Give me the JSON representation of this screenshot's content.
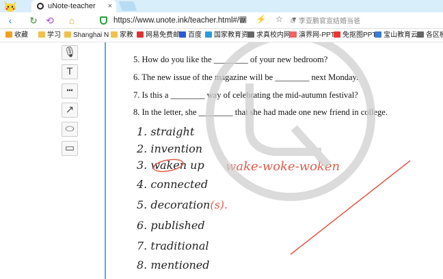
{
  "browser": {
    "tab_title": "uNote-teacher",
    "tab_close": "×",
    "url": "https://www.unote.ink/teacher.html#/w",
    "search_hint": "李亚鹏官宣结婚当爸",
    "nav": {
      "back": "‹",
      "refresh": "↻",
      "undo": "⟲",
      "home": "⌂"
    },
    "addr_icons": [
      "▦",
      "⚡",
      "☆",
      "▾"
    ],
    "bookmarks": [
      {
        "label": "收藏",
        "icon": "star-icon",
        "color": "#f0a020"
      },
      {
        "label": "学习",
        "icon": "folder-icon",
        "color": "#f0c14b"
      },
      {
        "label": "Shanghai N",
        "icon": "folder-icon",
        "color": "#f0c14b"
      },
      {
        "label": "家教",
        "icon": "folder-icon",
        "color": "#f0c14b"
      },
      {
        "label": "网易免费邮",
        "icon": "mail-icon",
        "color": "#d33"
      },
      {
        "label": "百度",
        "icon": "baidu-icon",
        "color": "#2a5bd7"
      },
      {
        "label": "国家教育资",
        "icon": "globe-icon",
        "color": "#2a9dd7"
      },
      {
        "label": "求真校内网",
        "icon": "page-icon",
        "color": "#666"
      },
      {
        "label": "演界网-PPT",
        "icon": "cloud-icon",
        "color": "#e66"
      },
      {
        "label": "免抠图PPT",
        "icon": "ppt-icon",
        "color": "#e33"
      },
      {
        "label": "宝山教育云",
        "icon": "bs-icon",
        "color": "#3a7bd5"
      },
      {
        "label": "各区模拟",
        "icon": "page-icon",
        "color": "#666"
      }
    ]
  },
  "tools": [
    {
      "name": "mic-tool",
      "glyph": "🎙"
    },
    {
      "name": "text-tool",
      "glyph": "T"
    },
    {
      "name": "dashed-line-tool",
      "glyph": "┅"
    },
    {
      "name": "arrow-tool",
      "glyph": "↗"
    },
    {
      "name": "ellipse-tool",
      "glyph": "⬭"
    },
    {
      "name": "rectangle-tool",
      "glyph": "▭"
    }
  ],
  "sentences": [
    "5. How do you like the ________ of your new bedroom?",
    "6. The new issue of the magazine will be ________ next Monday.",
    "7. Is this a ________ way of celebrating the mid-autumn festival?",
    "8. In the letter, she ________ that she had made one new friend in college."
  ],
  "answers": [
    "1. straight",
    "2. invention",
    "3. waken up",
    "4. connected",
    "5. decoration",
    "6. published",
    "7. traditional",
    "8. mentioned"
  ],
  "answer_suffix": "(s).",
  "red_note": "wake-woke-woken",
  "colors": {
    "accent": "#5aa8e0",
    "red_ink": "#e25b4b",
    "watermark": "#cfcfcf"
  }
}
